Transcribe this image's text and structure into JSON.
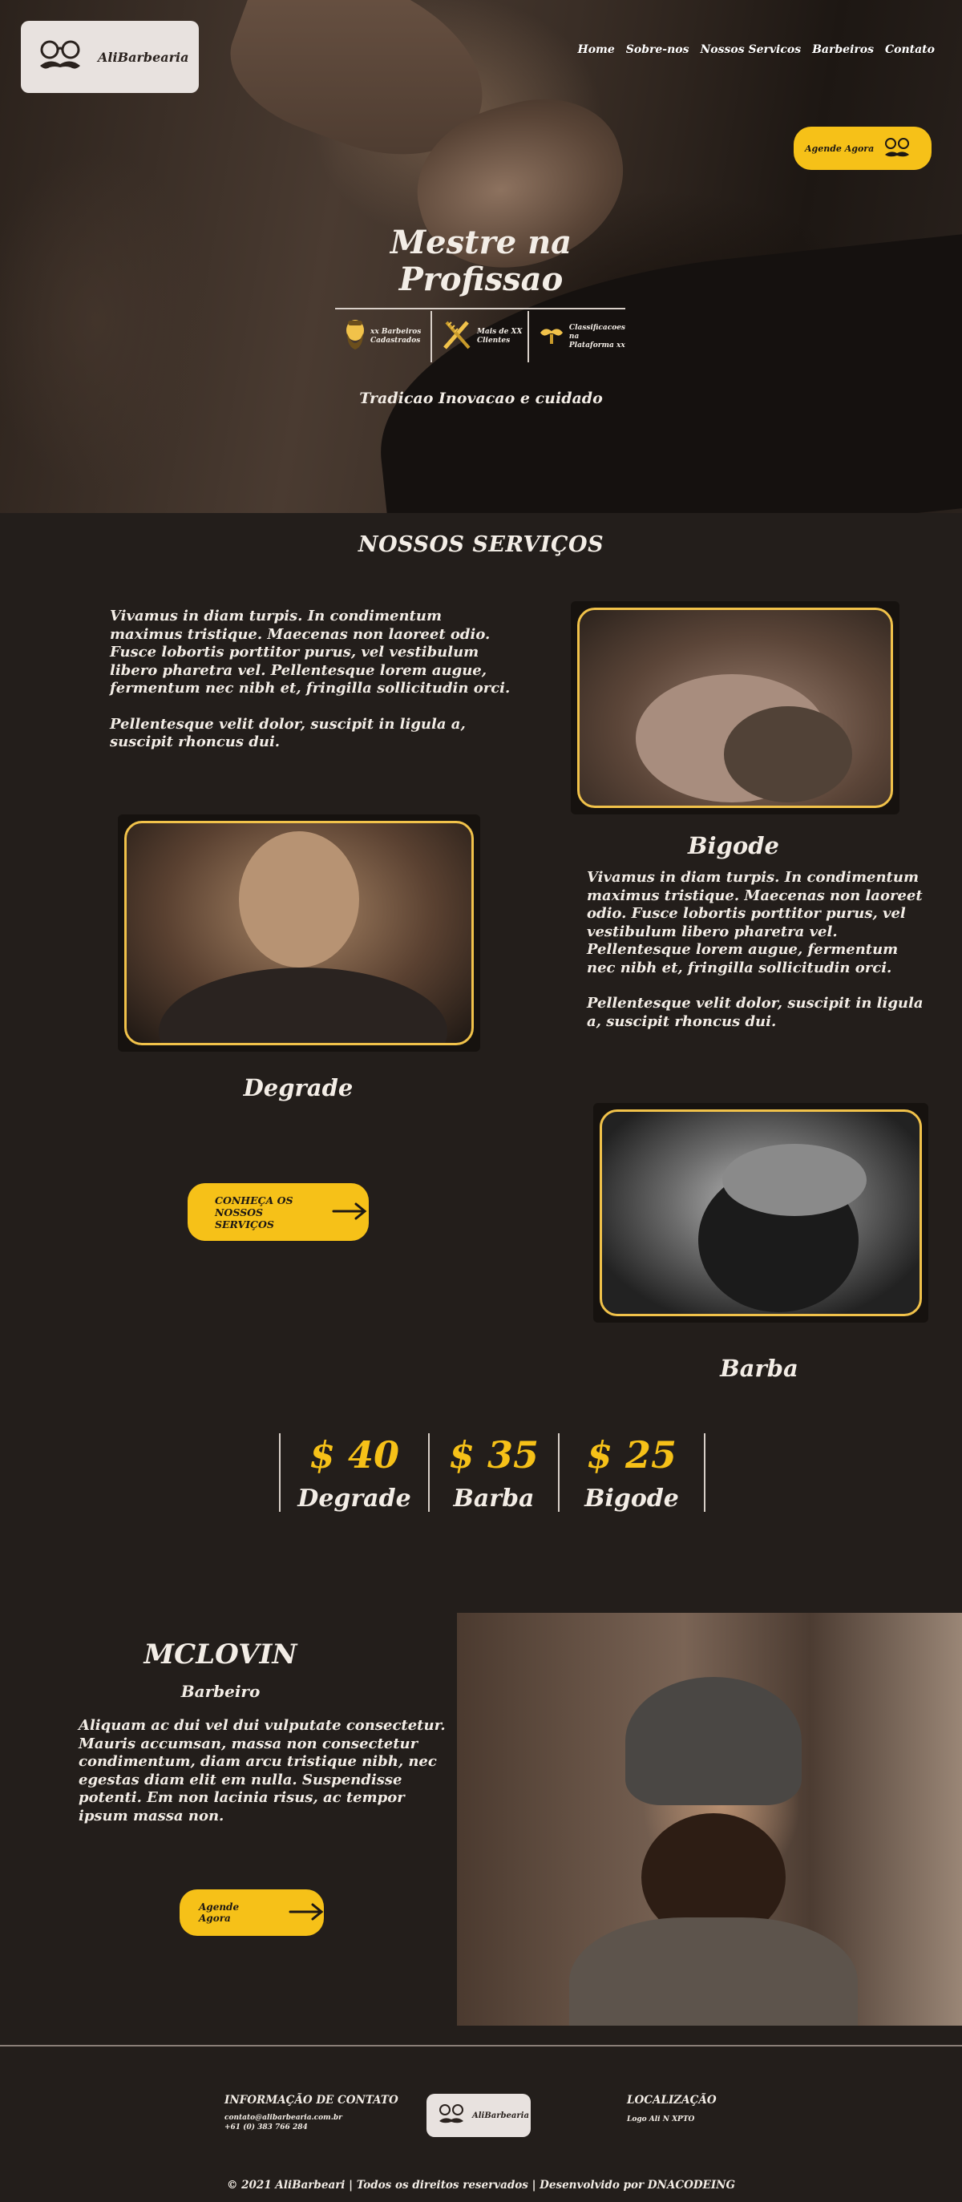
{
  "brand": {
    "name": "AliBarbearia"
  },
  "nav": [
    "Home",
    "Sobre-nos",
    "Nossos Servicos",
    "Barbeiros",
    "Contato"
  ],
  "hero": {
    "cta": "Agende Agora",
    "title_line1": "Mestre na",
    "title_line2": "Profissao",
    "stats": [
      {
        "icon": "bearded-man-icon",
        "text": "xx Barbeiros Cadastrados"
      },
      {
        "icon": "razor-comb-icon",
        "text": "Mais de XX Clientes"
      },
      {
        "icon": "mustache-icon",
        "text": "Classificacoes na Plataforma xx"
      }
    ],
    "tagline": "Tradicao Inovacao e cuidado"
  },
  "services": {
    "title": "NOSSOS SERVIÇOS",
    "intro_p1": "Vivamus in diam turpis. In condimentum maximus tristique. Maecenas non laoreet odio. Fusce lobortis porttitor purus, vel vestibulum libero pharetra vel. Pellentesque lorem augue, fermentum nec nibh et, fringilla sollicitudin orci.",
    "intro_p2": "Pellentesque velit dolor, suscipit in ligula a, suscipit rhoncus dui.",
    "bigode": {
      "name": "Bigode",
      "p1": "Vivamus in diam turpis. In condimentum maximus tristique. Maecenas non laoreet odio. Fusce lobortis porttitor purus, vel vestibulum libero pharetra vel. Pellentesque lorem augue, fermentum nec nibh et, fringilla sollicitudin orci.",
      "p2": "Pellentesque velit dolor, suscipit in ligula a, suscipit rhoncus dui."
    },
    "degrade": {
      "name": "Degrade"
    },
    "barba": {
      "name": "Barba"
    },
    "cta": "CONHEÇA OS NOSSOS SERVIÇOS"
  },
  "prices": [
    {
      "value": "$ 40",
      "name": "Degrade"
    },
    {
      "value": "$ 35",
      "name": "Barba"
    },
    {
      "value": "$ 25",
      "name": "Bigode"
    }
  ],
  "barber": {
    "name": "MCLOVIN",
    "role": "Barbeiro",
    "bio": "Aliquam ac dui vel dui vulputate consectetur. Mauris accumsan, massa non consectetur condimentum, diam arcu tristique nibh, nec egestas diam elit em nulla. Suspendisse potenti. Em non lacinia risus, ac tempor ipsum massa non.",
    "cta": "Agende Agora"
  },
  "footer": {
    "contact_title": "INFORMAÇÃO DE CONTATO",
    "email": "contato@alibarbearia.com.br",
    "phone": "+61 (0) 383 766 284",
    "location_title": "LOCALIZAÇÃO",
    "address": "Logo Ali N XPTO",
    "copyright": "© 2021 AliBarbeari | Todos os direitos reservados | Desenvolvido por DNACODEING"
  },
  "colors": {
    "accent": "#f6c118",
    "background": "#231e1b",
    "frame": "#f1c24a"
  }
}
